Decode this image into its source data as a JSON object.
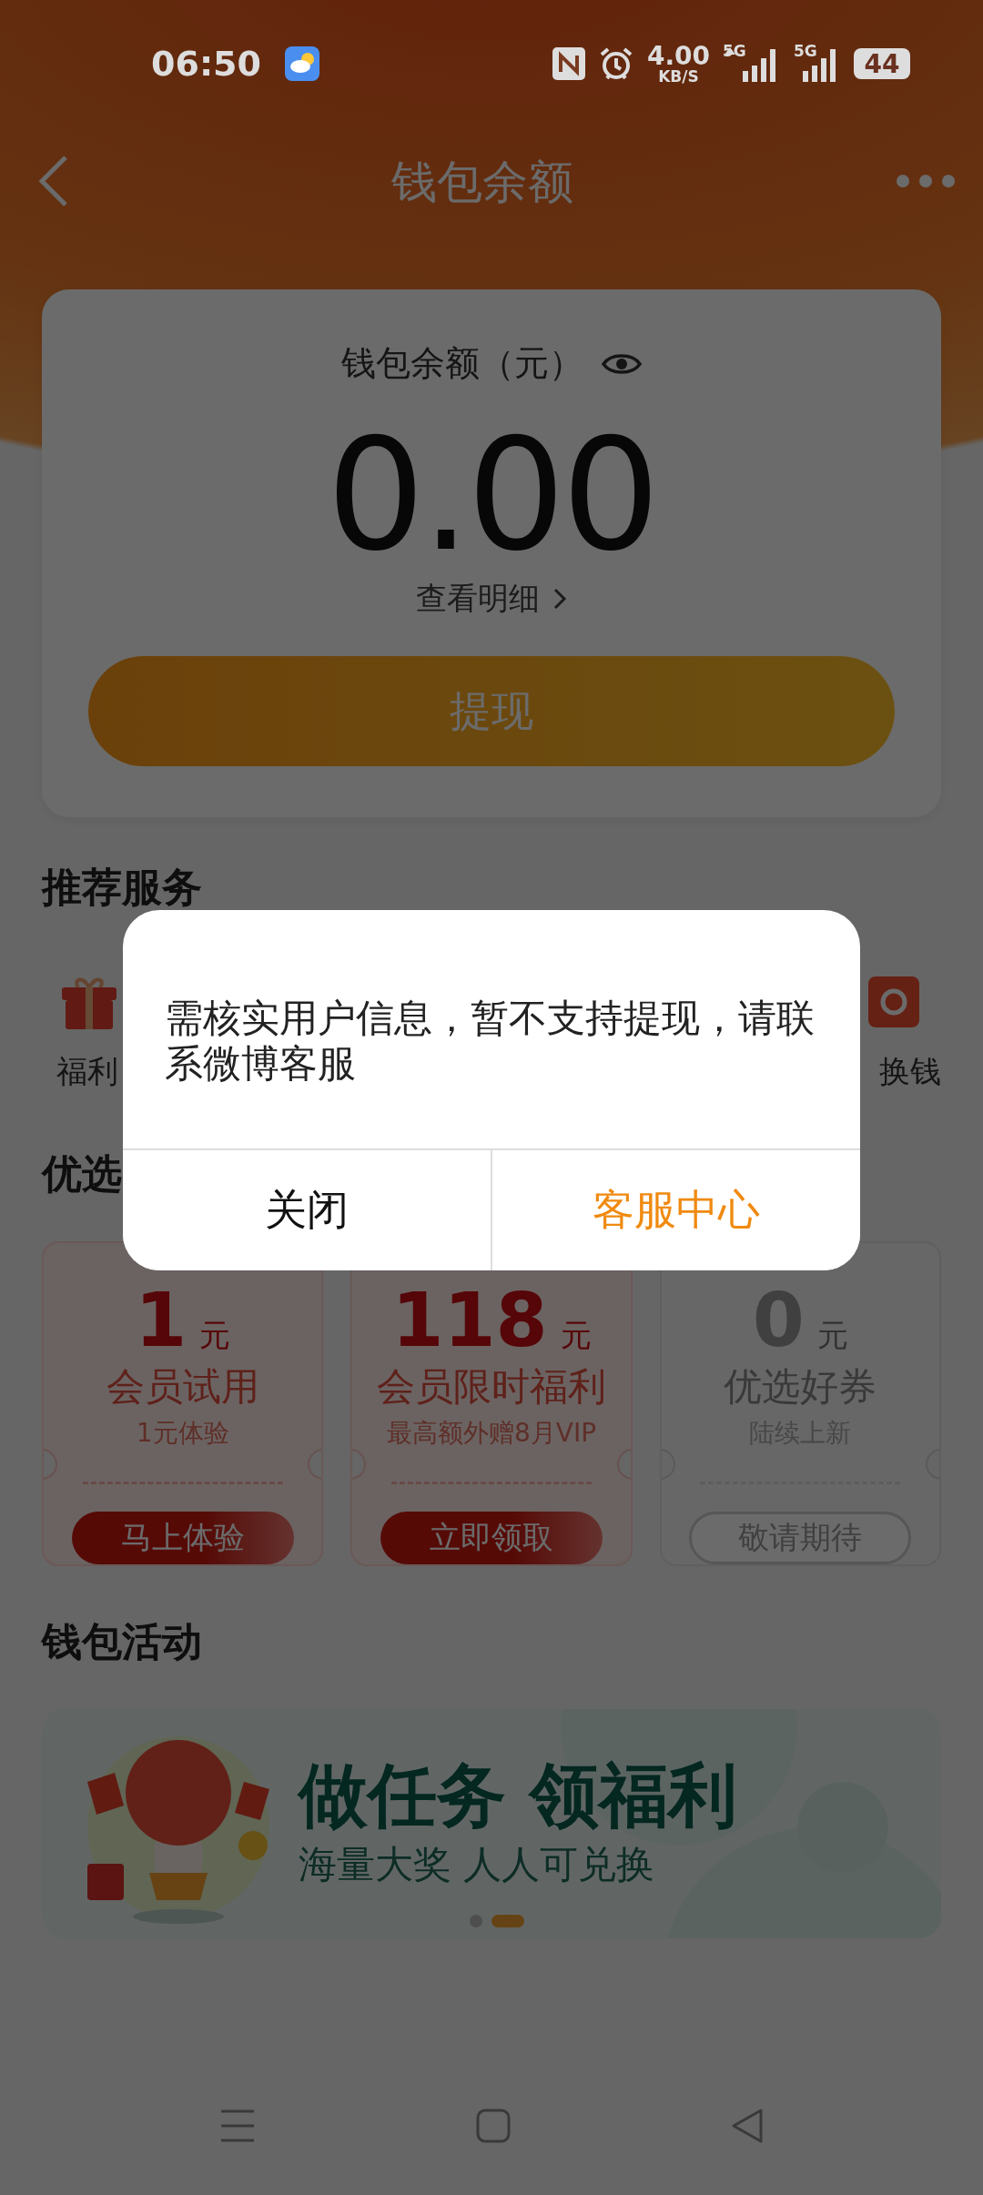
{
  "status_bar": {
    "time": "06:50",
    "network_speed": "4.00",
    "network_speed_unit": "KB/S",
    "network_1": "5G",
    "network_2": "5G",
    "battery": "44"
  },
  "header": {
    "title": "钱包余额"
  },
  "balance": {
    "label": "钱包余额（元）",
    "amount": "0.00",
    "details_link": "查看明细",
    "withdraw_button": "提现"
  },
  "services": {
    "title": "推荐服务",
    "items": [
      {
        "label": "福利"
      },
      {
        "label": "换钱"
      }
    ]
  },
  "picks": {
    "title": "优选",
    "coupons": [
      {
        "kind": "active",
        "amount": "1",
        "unit": "元",
        "title": "会员试用",
        "subtitle": "1元体验",
        "action": "马上体验"
      },
      {
        "kind": "active",
        "amount": "118",
        "unit": "元",
        "title": "会员限时福利",
        "subtitle": "最高额外赠8月VIP",
        "action": "立即领取"
      },
      {
        "kind": "upcoming",
        "amount": "0",
        "unit": "元",
        "title": "优选好券",
        "subtitle": "陆续上新",
        "action": "敬请期待"
      }
    ]
  },
  "activities": {
    "title": "钱包活动",
    "banner": {
      "headline": "做任务 领福利",
      "subline": "海量大奖 人人可兑换",
      "pages": [
        {
          "selected": false
        },
        {
          "selected": true
        }
      ]
    }
  },
  "dialog": {
    "message": "需核实用户信息，暂不支持提现，请联系微博客服",
    "buttons": [
      {
        "label": "关闭",
        "kind": "secondary"
      },
      {
        "label": "客服中心",
        "kind": "primary"
      }
    ]
  }
}
